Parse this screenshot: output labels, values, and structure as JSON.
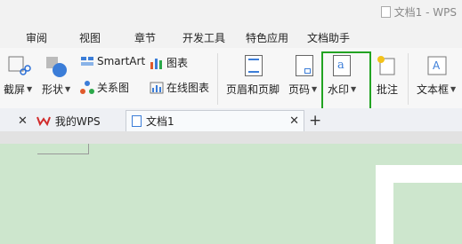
{
  "window": {
    "title": "文档1 - WPS"
  },
  "menu": {
    "items": [
      "审阅",
      "视图",
      "章节",
      "开发工具",
      "特色应用",
      "文档助手"
    ]
  },
  "ribbon": {
    "screenshot": "截屏",
    "shape": "形状",
    "smartart": "SmartArt",
    "relation": "关系图",
    "chart": "图表",
    "online_chart": "在线图表",
    "header_footer": "页眉和页脚",
    "page_number": "页码",
    "watermark": "水印",
    "comment": "批注",
    "textbox": "文本框"
  },
  "tabs": {
    "my_wps": "我的WPS",
    "doc1": "文档1",
    "add": "+"
  },
  "colors": {
    "highlight": "#22a322",
    "canvas": "#cde6cd"
  }
}
